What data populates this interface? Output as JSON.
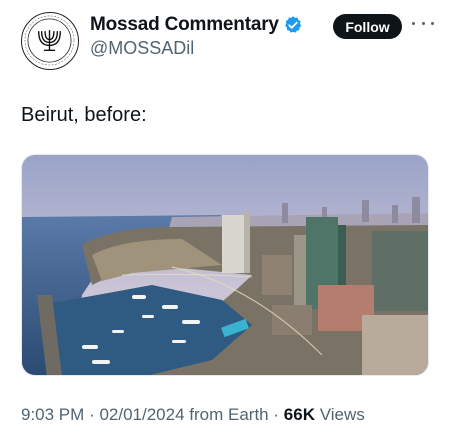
{
  "tweet": {
    "author": {
      "display_name": "Mossad Commentary",
      "handle": "@MOSSADil",
      "verified": true,
      "avatar_icon": "mossad-emblem-icon",
      "verified_icon": "verified-badge-icon",
      "verified_color": "#1d9bf0"
    },
    "follow_label": "Follow",
    "more_icon": "more-options-icon",
    "text": "Beirut, before:",
    "media_description_icon": "city-photo",
    "time": "9:03 PM",
    "separator": "·",
    "date": "02/01/2024",
    "source": "from Earth",
    "views_count": "66K",
    "views_label": "Views"
  },
  "colors": {
    "text_primary": "#0f1419",
    "text_secondary": "#536471",
    "follow_bg": "#0f1419",
    "follow_text": "#ffffff"
  }
}
